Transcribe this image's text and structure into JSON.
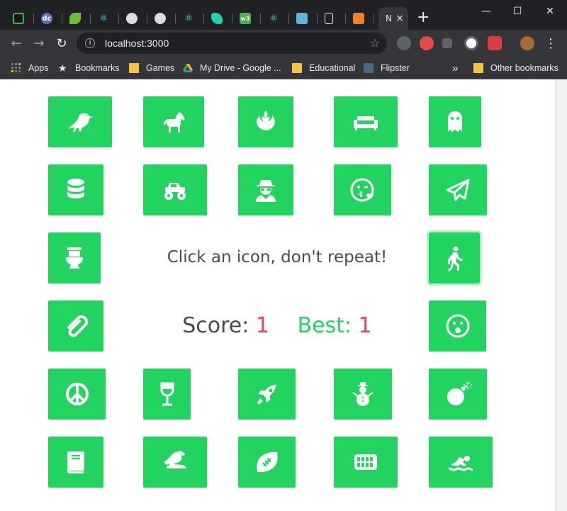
{
  "browser": {
    "tab_close": "×",
    "new_tab": "+",
    "active_tab_label": "N",
    "url": "localhost:3000",
    "window_controls": {
      "minimize": "—",
      "maximize": "☐",
      "close": "✕"
    },
    "nav": {
      "back": "←",
      "forward": "→",
      "reload": "↻",
      "info": "i",
      "star": "☆",
      "menu": "⋮"
    }
  },
  "tabs": [
    {
      "icon": "codepen-tab-icon",
      "color": "#4caf50"
    },
    {
      "icon": "dc-tab-icon",
      "color": "#5b6dbf"
    },
    {
      "icon": "leaf-tab-icon",
      "color": "#6cbf3a"
    },
    {
      "icon": "react-tab-icon",
      "color": "#61dafb"
    },
    {
      "icon": "github-tab-icon",
      "color": "#dddddd"
    },
    {
      "icon": "github-tab-icon",
      "color": "#dddddd"
    },
    {
      "icon": "react-tab-icon",
      "color": "#61dafb"
    },
    {
      "icon": "teal-tab-icon",
      "color": "#1fd1b0"
    },
    {
      "icon": "w3-tab-icon",
      "color": "#4caf50"
    },
    {
      "icon": "react-tab-icon",
      "color": "#61dafb"
    },
    {
      "icon": "bird-tab-icon",
      "color": "#5bb8d6"
    },
    {
      "icon": "page-tab-icon",
      "color": "#e8eaed"
    },
    {
      "icon": "stack-tab-icon",
      "color": "#f48024"
    }
  ],
  "bookmarks": {
    "apps": "Apps",
    "bookmarks": "Bookmarks",
    "games": "Games",
    "drive": "My Drive - Google ...",
    "educational": "Educational",
    "flipster": "Flipster",
    "overflow": "»",
    "other": "Other bookmarks"
  },
  "game": {
    "instruction": "Click an icon, don't repeat!",
    "score_label": "Score:",
    "score": "1",
    "best_label": "Best:",
    "best": "1",
    "accent_color": "#22d45f",
    "number_color": "#e8415a"
  },
  "cards": [
    {
      "name": "crow-icon"
    },
    {
      "name": "horse-icon"
    },
    {
      "name": "rebel-icon"
    },
    {
      "name": "couch-icon"
    },
    {
      "name": "ghost-icon"
    },
    {
      "name": "database-icon"
    },
    {
      "name": "monster-truck-icon"
    },
    {
      "name": "user-secret-icon"
    },
    {
      "name": "kiss-wink-heart-icon"
    },
    {
      "name": "paper-plane-icon"
    },
    {
      "name": "toilet-icon"
    },
    {
      "name": "walking-icon"
    },
    {
      "name": "paperclip-icon"
    },
    {
      "name": "surprise-icon"
    },
    {
      "name": "peace-icon"
    },
    {
      "name": "wine-glass-icon"
    },
    {
      "name": "space-shuttle-icon"
    },
    {
      "name": "snowman-icon"
    },
    {
      "name": "bomb-icon"
    },
    {
      "name": "book-icon"
    },
    {
      "name": "dragon-icon"
    },
    {
      "name": "football-icon"
    },
    {
      "name": "keyboard-icon"
    },
    {
      "name": "swimmer-icon"
    }
  ]
}
